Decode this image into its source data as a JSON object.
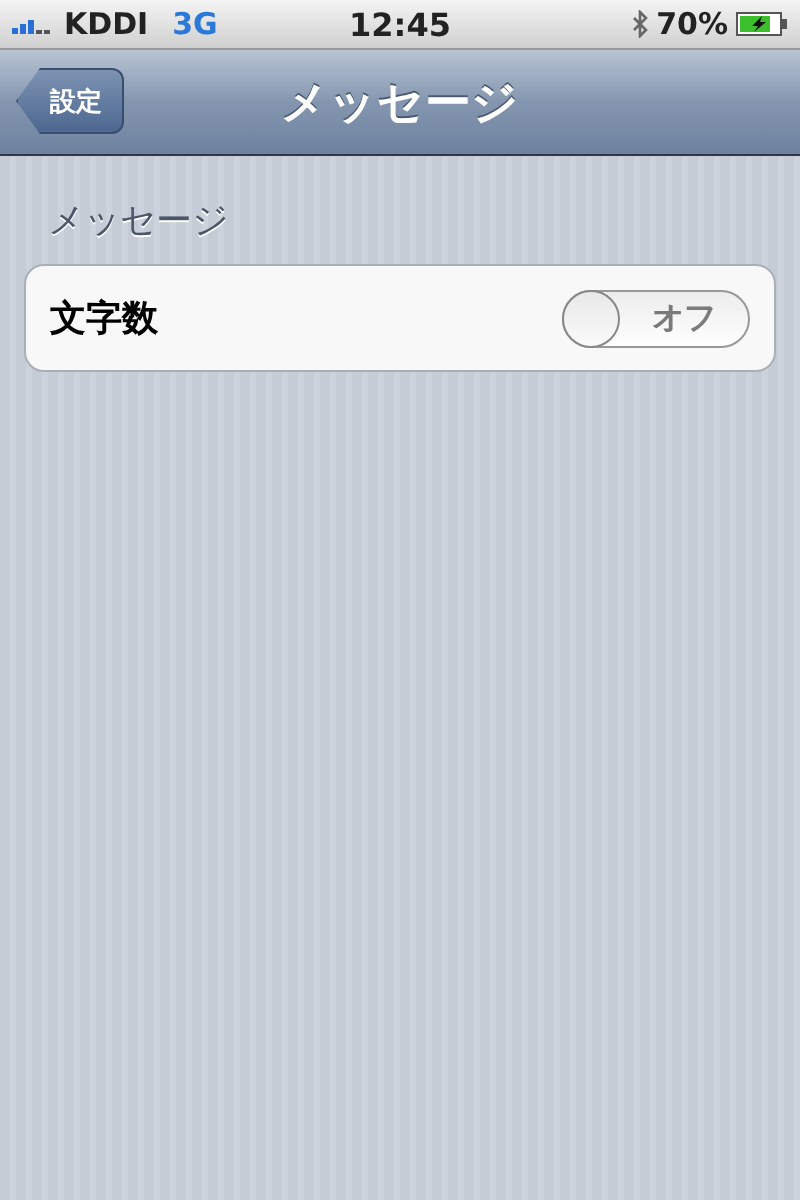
{
  "status_bar": {
    "carrier": "KDDI",
    "network": "3G",
    "time": "12:45",
    "battery_text": "70%"
  },
  "nav_bar": {
    "back_button": "設定",
    "title": "メッセージ"
  },
  "section": {
    "header": "メッセージ",
    "rows": [
      {
        "label": "文字数",
        "kind": "toggle",
        "on": false,
        "toggle_text": "オフ"
      }
    ]
  }
}
